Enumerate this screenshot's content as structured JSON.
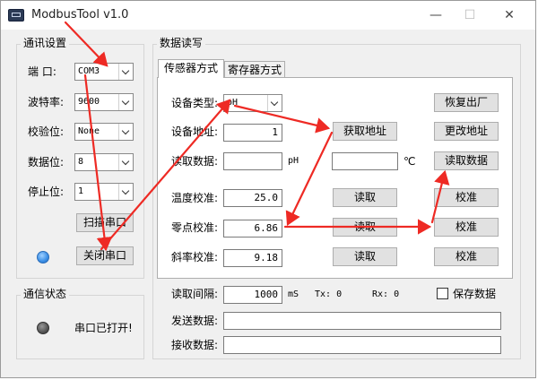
{
  "window": {
    "title": "ModbusTool v1.0",
    "minimize": "—",
    "maximize": "☐",
    "close": "✕"
  },
  "comm": {
    "group_label": "通讯设置",
    "port_label": "端  口:",
    "port_value": "COM3",
    "baud_label": "波特率:",
    "baud_value": "9600",
    "parity_label": "校验位:",
    "parity_value": "None",
    "databits_label": "数据位:",
    "databits_value": "8",
    "stopbits_label": "停止位:",
    "stopbits_value": "1",
    "scan_button": "扫描串口",
    "close_button": "关闭串口"
  },
  "status": {
    "group_label": "通信状态",
    "text": "串口已打开!"
  },
  "rw": {
    "group_label": "数据读写",
    "tabs": [
      "传感器方式",
      "寄存器方式"
    ],
    "device_type_label": "设备类型:",
    "device_type_value": "pH",
    "device_addr_label": "设备地址:",
    "device_addr_value": "1",
    "read_data_label": "读取数据:",
    "read_data_value": "",
    "read_data_unit": "pH",
    "temp_value": "",
    "temp_unit": "℃",
    "temp_cal_label": "温度校准:",
    "temp_cal_value": "25.0",
    "zero_cal_label": "零点校准:",
    "zero_cal_value": "6.86",
    "slope_cal_label": "斜率校准:",
    "slope_cal_value": "9.18",
    "read_button": "读取",
    "calibrate_button": "校准",
    "get_addr_button": "获取地址",
    "factory_reset_button": "恢复出厂",
    "change_addr_button": "更改地址",
    "read_data_button": "读取数据"
  },
  "bottom": {
    "interval_label": "读取间隔:",
    "interval_value": "1000",
    "interval_unit": "mS",
    "tx_label": "Tx: 0",
    "rx_label": "Rx: 0",
    "save_label": "保存数据",
    "send_label": "发送数据:",
    "send_value": "",
    "recv_label": "接收数据:",
    "recv_value": ""
  },
  "colors": {
    "arrow": "#ee2a24",
    "led_blue": "#3a8ee6",
    "led_gray": "#555555"
  }
}
